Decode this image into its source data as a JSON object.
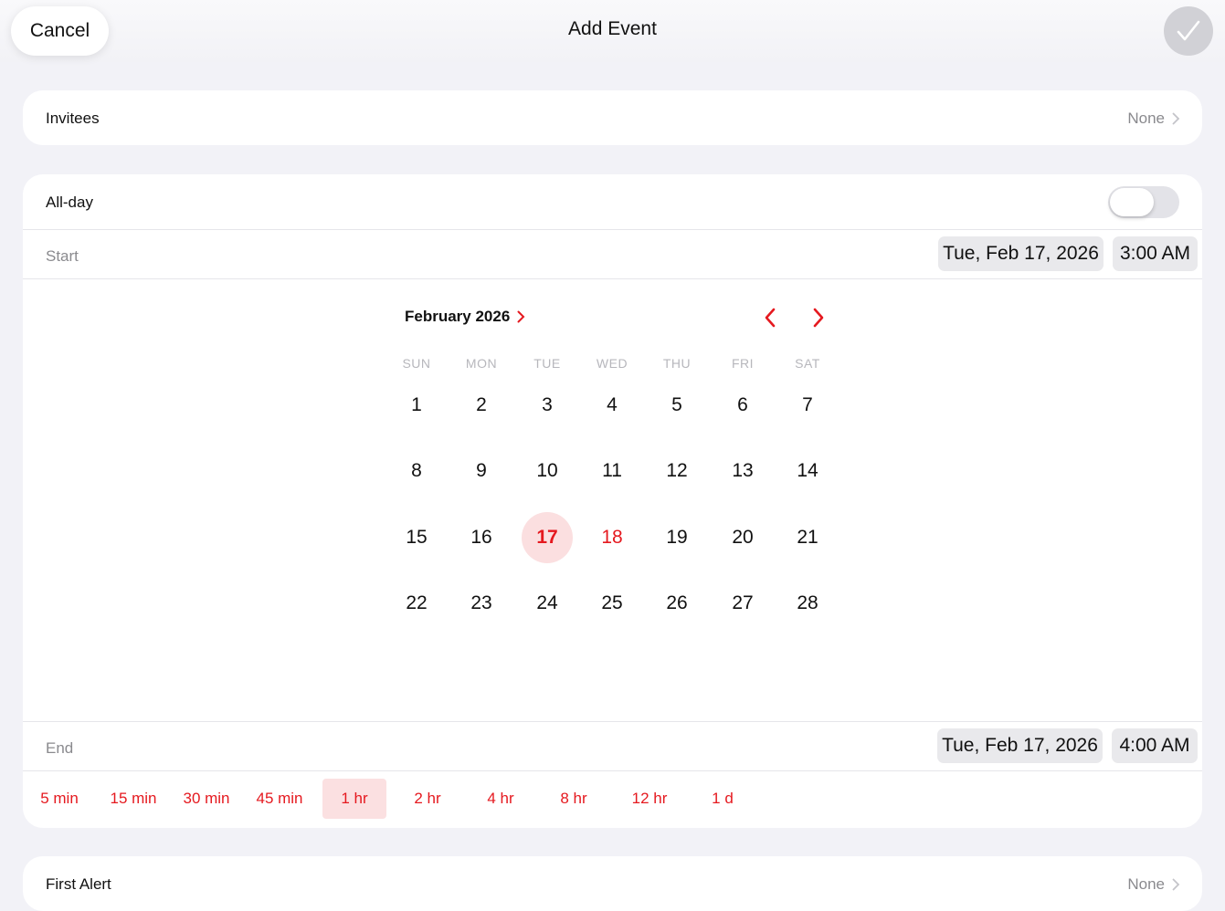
{
  "header": {
    "cancel_label": "Cancel",
    "title": "Add Event",
    "done_icon": "checkmark-icon"
  },
  "invitees": {
    "label": "Invitees",
    "value": "None"
  },
  "all_day": {
    "label": "All-day",
    "on": false
  },
  "start": {
    "label": "Start",
    "date": "Tue, Feb 17, 2026",
    "time": "3:00 AM"
  },
  "calendar": {
    "month_title": "February 2026",
    "weekdays": [
      "SUN",
      "MON",
      "TUE",
      "WED",
      "THU",
      "FRI",
      "SAT"
    ],
    "weeks": [
      [
        "1",
        "2",
        "3",
        "4",
        "5",
        "6",
        "7"
      ],
      [
        "8",
        "9",
        "10",
        "11",
        "12",
        "13",
        "14"
      ],
      [
        "15",
        "16",
        "17",
        "18",
        "19",
        "20",
        "21"
      ],
      [
        "22",
        "23",
        "24",
        "25",
        "26",
        "27",
        "28"
      ]
    ],
    "selected_day": "17",
    "today_day": "18",
    "accent": "#e5191f"
  },
  "end": {
    "label": "End",
    "date": "Tue, Feb 17, 2026",
    "time": "4:00 AM"
  },
  "durations": [
    "5 min",
    "15 min",
    "30 min",
    "45 min",
    "1 hr",
    "2 hr",
    "4 hr",
    "8 hr",
    "12 hr",
    "1 d"
  ],
  "active_duration": "1 hr",
  "first_alert": {
    "label": "First Alert",
    "value": "None"
  }
}
